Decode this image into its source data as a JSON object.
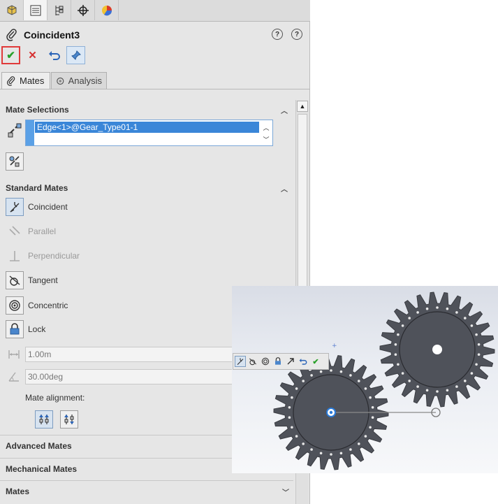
{
  "feature": {
    "title": "Coincident3"
  },
  "tabs": [
    {
      "label": "Mates"
    },
    {
      "label": "Analysis"
    }
  ],
  "mate_selections": {
    "heading": "Mate Selections",
    "items": [
      "Edge<1>@Gear_Type01-1"
    ]
  },
  "standard_mates": {
    "heading": "Standard Mates",
    "items": [
      {
        "label": "Coincident",
        "icon": "coincident-icon",
        "state": "active"
      },
      {
        "label": "Parallel",
        "icon": "parallel-icon",
        "state": "disabled"
      },
      {
        "label": "Perpendicular",
        "icon": "perpendicular-icon",
        "state": "disabled"
      },
      {
        "label": "Tangent",
        "icon": "tangent-icon",
        "state": "enabled"
      },
      {
        "label": "Concentric",
        "icon": "concentric-icon",
        "state": "enabled"
      },
      {
        "label": "Lock",
        "icon": "lock-icon",
        "state": "enabled"
      }
    ],
    "distance_value": "1.00m",
    "angle_value": "30.00deg",
    "alignment_label": "Mate alignment:"
  },
  "collapsed_sections": [
    {
      "label": "Advanced Mates"
    },
    {
      "label": "Mechanical Mates"
    },
    {
      "label": "Mates"
    }
  ],
  "colors": {
    "accent_blue": "#3a86d8",
    "ok_green": "#2aa02a",
    "cancel_red": "#d63030",
    "gear_fill": "#4f525a"
  }
}
